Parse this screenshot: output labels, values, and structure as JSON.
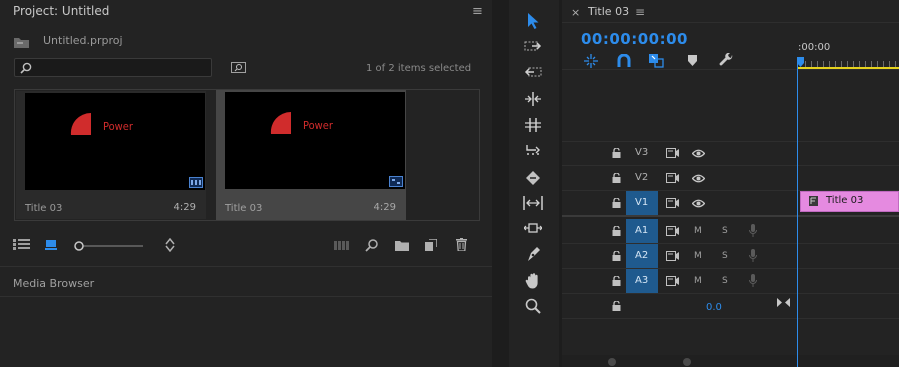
{
  "project": {
    "title": "Project: Untitled",
    "file": "Untitled.prproj",
    "selection_status": "1 of 2 items selected",
    "items": [
      {
        "name": "Title 03",
        "duration": "4:29",
        "text": "Power",
        "selected": false
      },
      {
        "name": "Title 03",
        "duration": "4:29",
        "text": "Power",
        "selected": true
      }
    ]
  },
  "media_browser": {
    "title": "Media Browser"
  },
  "timeline": {
    "tab_title": "Title 03",
    "timecode": "00:00:00:00",
    "ruler_start": ":00:00",
    "tracks": {
      "video": [
        {
          "label": "V3",
          "selected": false
        },
        {
          "label": "V2",
          "selected": false
        },
        {
          "label": "V1",
          "selected": true
        }
      ],
      "audio": [
        {
          "label": "A1",
          "selected": true,
          "m": "M",
          "s": "S"
        },
        {
          "label": "A2",
          "selected": true,
          "m": "M",
          "s": "S"
        },
        {
          "label": "A3",
          "selected": true,
          "m": "M",
          "s": "S"
        }
      ]
    },
    "master_value": "0.0",
    "clip": {
      "name": "Title 03"
    }
  },
  "colors": {
    "accent": "#2d8ceb",
    "clip": "#e58ae0",
    "track_selected": "#1f5a8e"
  }
}
